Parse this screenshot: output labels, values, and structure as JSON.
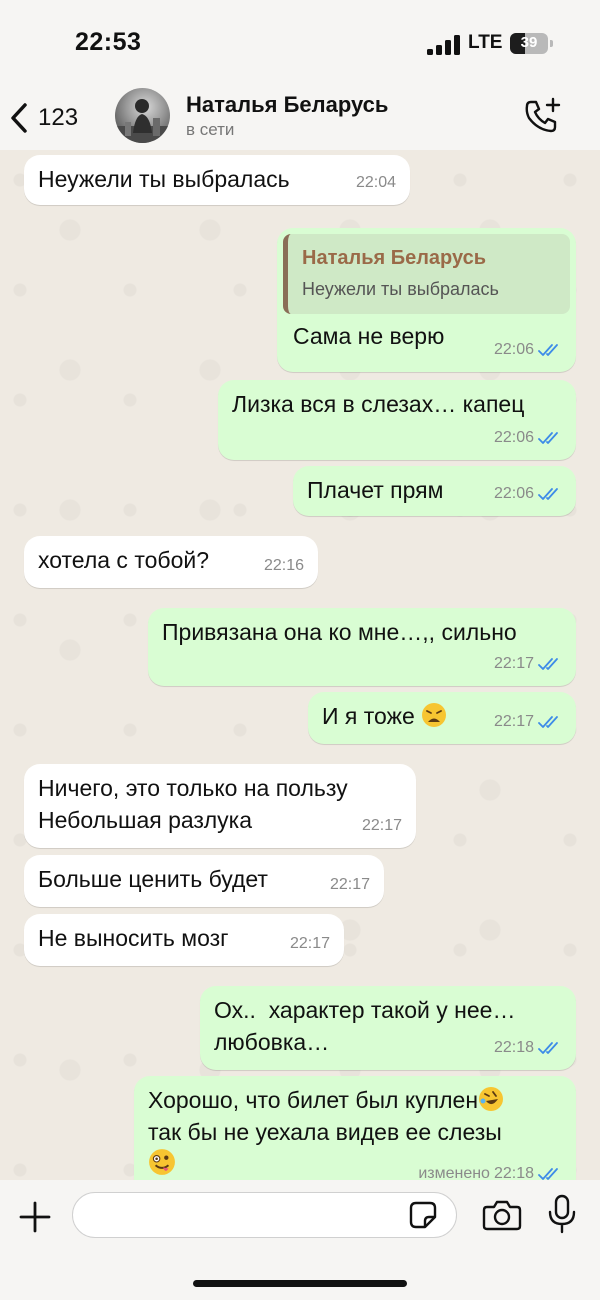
{
  "status_bar": {
    "time": "22:53",
    "network": "LTE",
    "battery": "39",
    "battery_level": 0.39
  },
  "header": {
    "back_count": "123",
    "contact_name": "Наталья Беларусь",
    "presence": "в сети"
  },
  "messages": [
    {
      "direction": "in",
      "text": "Неужели ты выбралась",
      "time": "22:04"
    },
    {
      "direction": "out",
      "reply_to": {
        "name": "Наталья Беларусь",
        "text": "Неужели ты выбралась"
      },
      "text": "Сама не верю",
      "time": "22:06",
      "status": "read"
    },
    {
      "direction": "out",
      "text": "Лизка вся в слезах… капец",
      "time": "22:06",
      "status": "read"
    },
    {
      "direction": "out",
      "text": "Плачет прям",
      "time": "22:06",
      "status": "read"
    },
    {
      "direction": "in",
      "text": "хотела с тобой?",
      "time": "22:16"
    },
    {
      "direction": "out",
      "text": "Привязана она ко мне…,, сильно",
      "time": "22:17",
      "status": "read"
    },
    {
      "direction": "out",
      "text": "И я тоже",
      "emoji": "weary-face",
      "time": "22:17",
      "status": "read"
    },
    {
      "direction": "in",
      "text": "Ничего, это только на пользу\nНебольшая разлука",
      "time": "22:17"
    },
    {
      "direction": "in",
      "text": "Больше ценить будет",
      "time": "22:17"
    },
    {
      "direction": "in",
      "text": "Не выносить мозг",
      "time": "22:17"
    },
    {
      "direction": "out",
      "text": "Ох..  характер такой у нее…\nлюбовка…",
      "time": "22:18",
      "status": "read"
    },
    {
      "direction": "out",
      "text": "Хорошо, что билет был куплен",
      "emoji": "rofl-face",
      "text2": "так бы не уехала видев ее слезы",
      "emoji2": "zany-face",
      "edited_label": "изменено",
      "time": "22:18",
      "status": "read"
    }
  ],
  "input": {
    "placeholder": ""
  },
  "icons": {
    "back": "chevron-left-icon",
    "call": "phone-add-icon",
    "plus": "plus-icon",
    "sticker": "sticker-icon",
    "camera": "camera-icon",
    "mic": "microphone-icon"
  },
  "colors": {
    "incoming": "#ffffff",
    "outgoing": "#d9fdd3",
    "read_check": "#3d8be8",
    "chat_background": "#efeae2",
    "quote_name": "#9a6a48"
  }
}
